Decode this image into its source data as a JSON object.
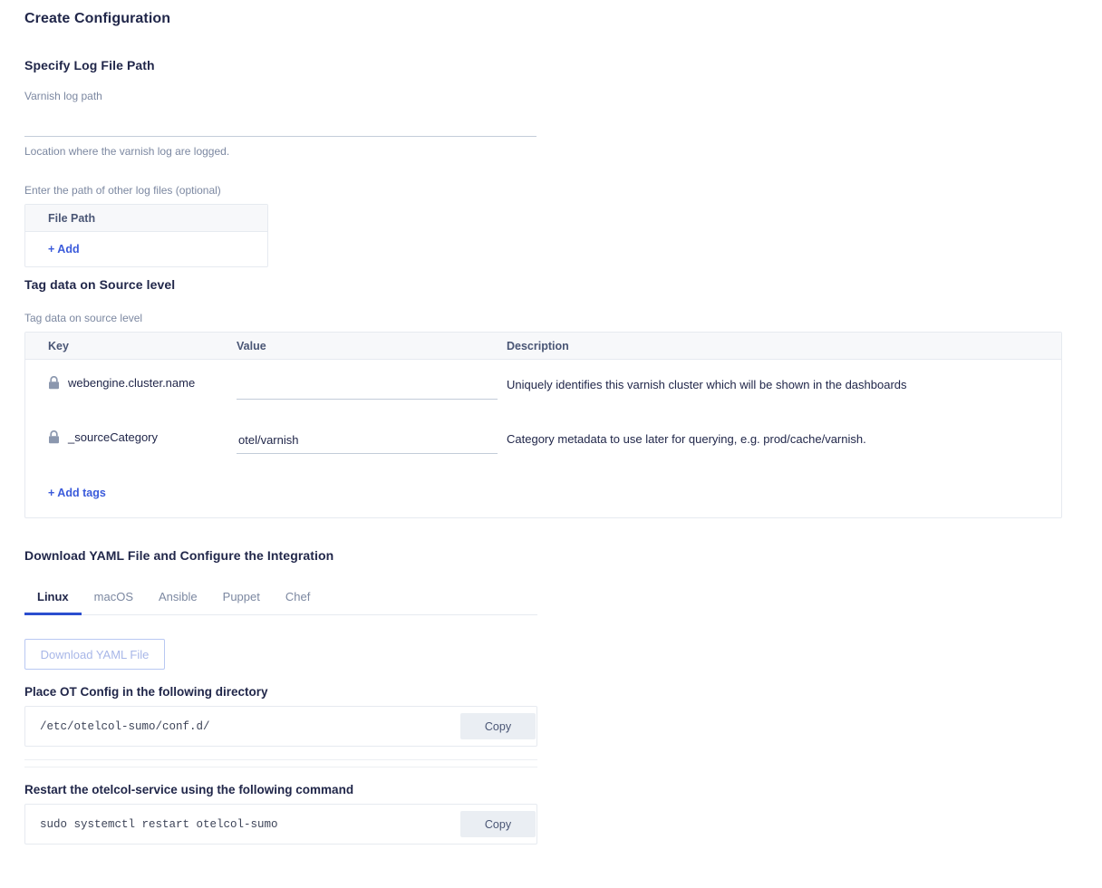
{
  "page": {
    "title": "Create Configuration"
  },
  "log_path_section": {
    "heading": "Specify Log File Path",
    "varnish_label": "Varnish log path",
    "varnish_value": "",
    "varnish_placeholder": "",
    "varnish_help": "Location where the varnish log are logged.",
    "other_label": "Enter the path of other log files (optional)",
    "file_path_table": {
      "header": "File Path",
      "add_label": "+ Add"
    }
  },
  "tag_section": {
    "heading": "Tag data on Source level",
    "label": "Tag data on source level",
    "columns": {
      "key": "Key",
      "value": "Value",
      "description": "Description"
    },
    "rows": [
      {
        "icon": "lock-icon",
        "key": "webengine.cluster.name",
        "value": "",
        "description": "Uniquely identifies this varnish cluster which will be shown in the dashboards"
      },
      {
        "icon": "lock-icon",
        "key": "_sourceCategory",
        "value": "otel/varnish",
        "description": "Category metadata to use later for querying, e.g. prod/cache/varnish."
      }
    ],
    "add_tags_label": "+ Add tags"
  },
  "yaml_section": {
    "heading": "Download YAML File and Configure the Integration",
    "tabs": [
      {
        "label": "Linux",
        "active": true
      },
      {
        "label": "macOS",
        "active": false
      },
      {
        "label": "Ansible",
        "active": false
      },
      {
        "label": "Puppet",
        "active": false
      },
      {
        "label": "Chef",
        "active": false
      }
    ],
    "download_button": "Download YAML File",
    "config_dir_heading": "Place OT Config in the following directory",
    "config_dir_value": "/etc/otelcol-sumo/conf.d/",
    "config_dir_copy": "Copy",
    "restart_heading": "Restart the otelcol-service using the following command",
    "restart_command": "sudo systemctl restart otelcol-sumo",
    "restart_copy": "Copy"
  },
  "colors": {
    "heading": "#21274a",
    "muted": "#7c88a1",
    "link": "#3b5bdb",
    "accent": "#2c4ecf",
    "border": "#e6eaf0",
    "header_bg": "#f7f8fa",
    "copy_bg": "#eaeef3",
    "disabled_border": "#b9c8f2",
    "disabled_text": "#a8b7e8",
    "lock": "#8b97ae"
  }
}
